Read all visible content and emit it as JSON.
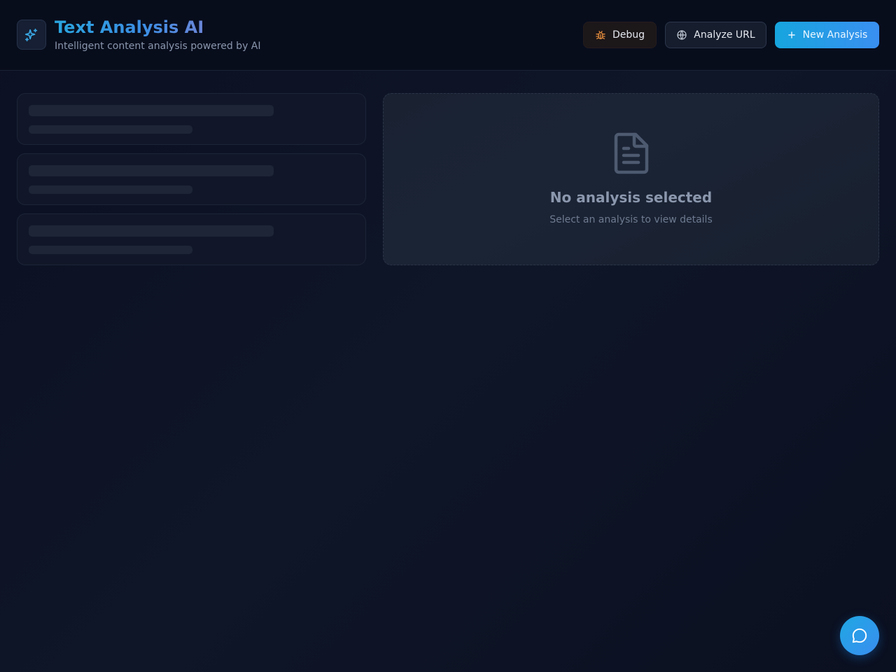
{
  "header": {
    "title": "Text Analysis AI",
    "subtitle": "Intelligent content analysis powered by AI",
    "logo_icon": "sparkles-icon"
  },
  "toolbar": {
    "debug_label": "Debug",
    "debug_icon": "bug-icon",
    "analyze_url_label": "Analyze URL",
    "analyze_url_icon": "globe-icon",
    "new_analysis_label": "New Analysis",
    "new_analysis_icon": "plus-icon"
  },
  "analysis_list": {
    "loading": true,
    "placeholder_count": 3
  },
  "detail": {
    "empty_title": "No analysis selected",
    "empty_subtitle": "Select an analysis to view details",
    "empty_icon": "document-icon"
  },
  "chat": {
    "icon": "chat-bubble-icon"
  },
  "colors": {
    "accent": "#1fa7e3",
    "accent_end": "#3a8ef0",
    "debug_icon": "#e08a3c",
    "background": "#0d1324"
  }
}
